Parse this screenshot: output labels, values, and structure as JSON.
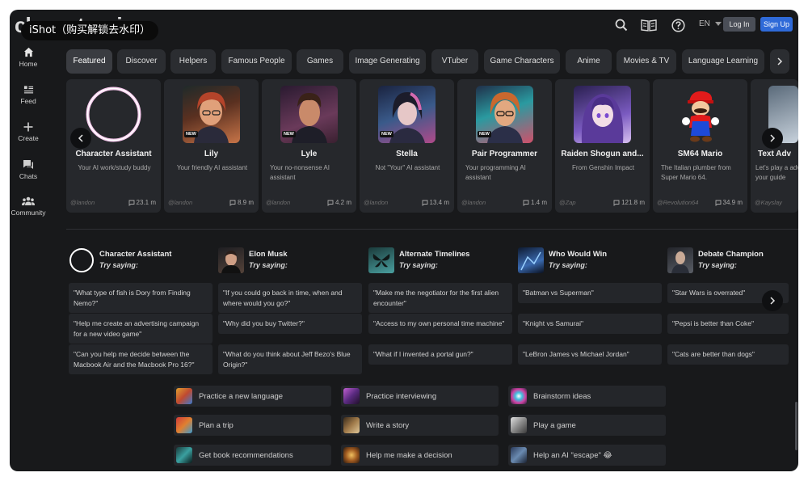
{
  "app": {
    "logo_text": "character.ai",
    "watermark": "iShot（购买解锁去水印）"
  },
  "header": {
    "language": "EN",
    "login_label": "Log In",
    "signup_label": "Sign Up"
  },
  "sidebar": {
    "items": [
      {
        "label": "Home",
        "icon": "home-icon"
      },
      {
        "label": "Feed",
        "icon": "feed-icon"
      },
      {
        "label": "Create",
        "icon": "plus-icon"
      },
      {
        "label": "Chats",
        "icon": "chat-icon"
      },
      {
        "label": "Community",
        "icon": "community-icon"
      }
    ]
  },
  "tabs": [
    "Featured",
    "Discover",
    "Helpers",
    "Famous People",
    "Games",
    "Image Generating",
    "VTuber",
    "Game Characters",
    "Anime",
    "Movies & TV",
    "Language Learning"
  ],
  "active_tab": "Featured",
  "cards": [
    {
      "name": "Character Assistant",
      "desc": "Your AI work/study buddy",
      "author": "@landon",
      "count": "23.1 m",
      "badge": "",
      "colors": [
        "#ffffff",
        "#ff8fd8"
      ]
    },
    {
      "name": "Lily",
      "desc": "Your friendly AI assistant",
      "author": "@landon",
      "count": "8.9 m",
      "badge": "NEW",
      "colors": [
        "#5a2a1e",
        "#c0683f"
      ]
    },
    {
      "name": "Lyle",
      "desc": "Your no-nonsense AI assistant",
      "author": "@landon",
      "count": "4.2 m",
      "badge": "NEW",
      "colors": [
        "#3a1e3a",
        "#8a4a7a"
      ]
    },
    {
      "name": "Stella",
      "desc": "Not \"Your\" AI assistant",
      "author": "@landon",
      "count": "13.4 m",
      "badge": "NEW",
      "colors": [
        "#1e2a4a",
        "#c05a9a"
      ]
    },
    {
      "name": "Pair Programmer",
      "desc": "Your programming AI assistant",
      "author": "@landon",
      "count": "1.4 m",
      "badge": "NEW",
      "colors": [
        "#2a3a5a",
        "#d0704a"
      ]
    },
    {
      "name": "Raiden Shogun and...",
      "desc": "From Genshin Impact",
      "author": "@Zap",
      "count": "121.8 m",
      "badge": "",
      "colors": [
        "#3a2a6a",
        "#9a7ad0"
      ]
    },
    {
      "name": "SM64 Mario",
      "desc": "The Italian plumber from Super Mario 64.",
      "author": "@Revolution64",
      "count": "34.9 m",
      "badge": "",
      "colors": [
        "#26282c",
        "#26282c"
      ]
    },
    {
      "name": "Text Adv",
      "desc": "Let's play a adventure g your guide",
      "author": "@Kayslay",
      "count": "",
      "badge": "",
      "colors": [
        "#4a5a6a",
        "#8a9aaa"
      ]
    }
  ],
  "try_columns": [
    {
      "name": "Character Assistant",
      "try": "Try saying:",
      "prompts": [
        "\"What type of fish is Dory from Finding Nemo?\"",
        "\"Help me create an advertising campaign for a new video game\"",
        "\"Can you help me decide between the Macbook Air and the Macbook Pro 16?\""
      ]
    },
    {
      "name": "Elon Musk",
      "try": "Try saying:",
      "prompts": [
        "\"If you could go back in time, when and where would you go?\"",
        "\"Why did you buy Twitter?\"",
        "\"What do you think about Jeff Bezo's Blue Origin?\""
      ]
    },
    {
      "name": "Alternate Timelines",
      "try": "Try saying:",
      "prompts": [
        "\"Make me the negotiator for the first alien encounter\"",
        "\"Access to my own personal time machine\"",
        "\"What if I invented a portal gun?\""
      ]
    },
    {
      "name": "Who Would Win",
      "try": "Try saying:",
      "prompts": [
        "\"Batman vs Superman\"",
        "\"Knight vs Samurai\"",
        "\"LeBron James vs Michael Jordan\""
      ]
    },
    {
      "name": "Debate Champion",
      "try": "Try saying:",
      "prompts": [
        "\"Star Wars is overrated\"",
        "\"Pepsi is better than Coke\"",
        "\"Cats are better than dogs\""
      ]
    }
  ],
  "suggestions": [
    {
      "label": "Practice a new language"
    },
    {
      "label": "Practice interviewing"
    },
    {
      "label": "Brainstorm ideas"
    },
    {
      "label": "Plan a trip"
    },
    {
      "label": "Write a story"
    },
    {
      "label": "Play a game"
    },
    {
      "label": "Get book recommendations"
    },
    {
      "label": "Help me make a decision"
    },
    {
      "label": "Help an AI \"escape\" 😂"
    }
  ]
}
